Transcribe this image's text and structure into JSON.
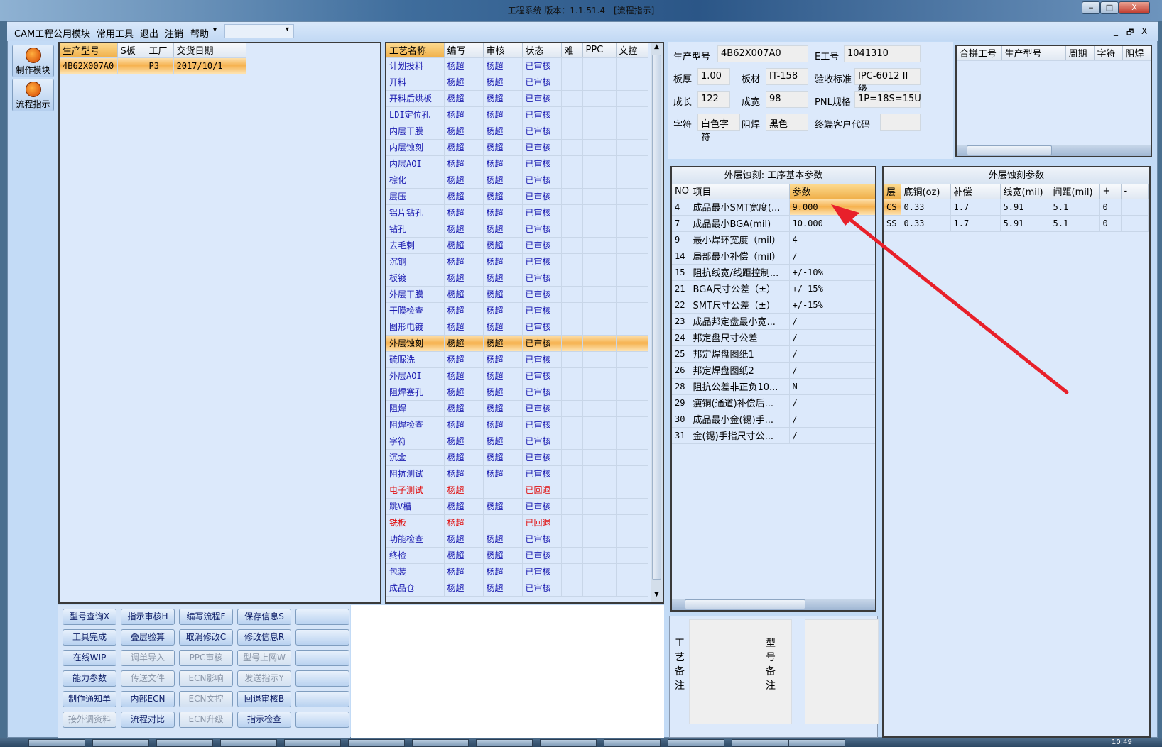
{
  "window": {
    "title": "工程系统  版本：1.1.51.4 - [流程指示]",
    "min": "‒",
    "max": "□",
    "close": "X",
    "mdi_min": "_",
    "mdi_restore": "🗗",
    "mdi_close": "X"
  },
  "menu": [
    "CAM工程",
    "公用模块",
    "常用工具",
    "退出",
    "注销",
    "帮助"
  ],
  "menu_more": "▾",
  "menu_combo": {
    "value": "",
    "arrow": "▾"
  },
  "nav": [
    {
      "label": "制作模块",
      "icon": "fire-icon"
    },
    {
      "label": "流程指示",
      "icon": "flow-icon"
    }
  ],
  "orders": {
    "columns": [
      "生产型号",
      "S板",
      "工厂",
      "交货日期"
    ],
    "rows": [
      [
        "4B62X007A0",
        "",
        "P3",
        "2017/10/1"
      ]
    ]
  },
  "process": {
    "columns": [
      "工艺名称",
      "编写",
      "审核",
      "状态",
      "难",
      "PPC",
      "文控"
    ],
    "rows": [
      [
        "计划投料",
        "杨超",
        "杨超",
        "已审核"
      ],
      [
        "开料",
        "杨超",
        "杨超",
        "已审核"
      ],
      [
        "开料后烘板",
        "杨超",
        "杨超",
        "已审核"
      ],
      [
        "LDI定位孔",
        "杨超",
        "杨超",
        "已审核"
      ],
      [
        "内层干膜",
        "杨超",
        "杨超",
        "已审核"
      ],
      [
        "内层蚀刻",
        "杨超",
        "杨超",
        "已审核"
      ],
      [
        "内层AOI",
        "杨超",
        "杨超",
        "已审核"
      ],
      [
        "棕化",
        "杨超",
        "杨超",
        "已审核"
      ],
      [
        "层压",
        "杨超",
        "杨超",
        "已审核"
      ],
      [
        "铝片钻孔",
        "杨超",
        "杨超",
        "已审核"
      ],
      [
        "钻孔",
        "杨超",
        "杨超",
        "已审核"
      ],
      [
        "去毛刺",
        "杨超",
        "杨超",
        "已审核"
      ],
      [
        "沉铜",
        "杨超",
        "杨超",
        "已审核"
      ],
      [
        "板镀",
        "杨超",
        "杨超",
        "已审核"
      ],
      [
        "外层干膜",
        "杨超",
        "杨超",
        "已审核"
      ],
      [
        "干膜检查",
        "杨超",
        "杨超",
        "已审核"
      ],
      [
        "图形电镀",
        "杨超",
        "杨超",
        "已审核"
      ],
      [
        "外层蚀刻",
        "杨超",
        "杨超",
        "已审核"
      ],
      [
        "硫脲洗",
        "杨超",
        "杨超",
        "已审核"
      ],
      [
        "外层AOI",
        "杨超",
        "杨超",
        "已审核"
      ],
      [
        "阻焊塞孔",
        "杨超",
        "杨超",
        "已审核"
      ],
      [
        "阻焊",
        "杨超",
        "杨超",
        "已审核"
      ],
      [
        "阻焊检查",
        "杨超",
        "杨超",
        "已审核"
      ],
      [
        "字符",
        "杨超",
        "杨超",
        "已审核"
      ],
      [
        "沉金",
        "杨超",
        "杨超",
        "已审核"
      ],
      [
        "阻抗测试",
        "杨超",
        "杨超",
        "已审核"
      ],
      [
        "电子测试",
        "杨超",
        "",
        "已回退"
      ],
      [
        "跳V槽",
        "杨超",
        "杨超",
        "已审核"
      ],
      [
        "铣板",
        "杨超",
        "",
        "已回退"
      ],
      [
        "功能检查",
        "杨超",
        "杨超",
        "已审核"
      ],
      [
        "终检",
        "杨超",
        "杨超",
        "已审核"
      ],
      [
        "包装",
        "杨超",
        "杨超",
        "已审核"
      ],
      [
        "成品仓",
        "杨超",
        "杨超",
        "已审核"
      ]
    ],
    "selected_index": 17,
    "rejected_color": "#e01010",
    "normal_color": "#1a1ab0"
  },
  "buttons": [
    [
      {
        "label": "型号查询X",
        "enabled": true
      },
      {
        "label": "指示审核H",
        "enabled": true
      },
      {
        "label": "编写流程F",
        "enabled": true
      },
      {
        "label": "保存信息S",
        "enabled": true
      },
      {
        "label": "",
        "enabled": true
      }
    ],
    [
      {
        "label": "工具完成",
        "enabled": true
      },
      {
        "label": "叠层验算",
        "enabled": true
      },
      {
        "label": "取消修改C",
        "enabled": true
      },
      {
        "label": "修改信息R",
        "enabled": true
      },
      {
        "label": "",
        "enabled": true
      }
    ],
    [
      {
        "label": "在线WIP",
        "enabled": true
      },
      {
        "label": "调单导入",
        "enabled": false
      },
      {
        "label": "PPC审核",
        "enabled": false
      },
      {
        "label": "型号上网W",
        "enabled": false
      },
      {
        "label": "",
        "enabled": true
      }
    ],
    [
      {
        "label": "能力参数",
        "enabled": true
      },
      {
        "label": "传送文件",
        "enabled": false
      },
      {
        "label": "ECN影响",
        "enabled": false
      },
      {
        "label": "发送指示Y",
        "enabled": false
      },
      {
        "label": "",
        "enabled": true
      }
    ],
    [
      {
        "label": "制作通知单",
        "enabled": true
      },
      {
        "label": "内部ECN",
        "enabled": true
      },
      {
        "label": "ECN文控",
        "enabled": false
      },
      {
        "label": "回退审核B",
        "enabled": true
      },
      {
        "label": "",
        "enabled": true
      }
    ],
    [
      {
        "label": "接外调资料",
        "enabled": false
      },
      {
        "label": "流程对比",
        "enabled": true
      },
      {
        "label": "ECN升级",
        "enabled": false
      },
      {
        "label": "指示检查",
        "enabled": true
      },
      {
        "label": "",
        "enabled": true
      }
    ]
  ],
  "info": {
    "model_label": "生产型号",
    "model": "4B62X007A0",
    "eno_label": "E工号",
    "eno": "1041310",
    "thick_label": "板厚",
    "thick": "1.00",
    "material_label": "板材",
    "material": "IT-158",
    "std_label": "验收标准",
    "std": "IPC-6012 II级",
    "len_label": "成长",
    "len": "122",
    "wid_label": "成宽",
    "wid": "98",
    "pnl_label": "PNL规格",
    "pnl": "1P=18S=15U",
    "char_label": "字符",
    "char": "白色字符",
    "mask_label": "阻焊",
    "mask": "黑色",
    "cust_label": "终端客户代码",
    "cust": ""
  },
  "merge": {
    "columns": [
      "合拼工号",
      "生产型号",
      "周期",
      "字符",
      "阻焊"
    ]
  },
  "params": {
    "title": "外层蚀刻: 工序基本参数",
    "columns": [
      "NO",
      "项目",
      "参数"
    ],
    "rows": [
      [
        "4",
        "成品最小SMT宽度(...",
        "9.000"
      ],
      [
        "7",
        "成品最小BGA(mil)",
        "10.000"
      ],
      [
        "9",
        "最小焊环宽度（mil）",
        "4"
      ],
      [
        "14",
        "局部最小补偿（mil）",
        "/"
      ],
      [
        "15",
        "阻抗线宽/线距控制...",
        "+/-10%"
      ],
      [
        "21",
        "BGA尺寸公差（±）",
        "+/-15%"
      ],
      [
        "22",
        "SMT尺寸公差（±）",
        "+/-15%"
      ],
      [
        "23",
        "成品邦定盘最小宽...",
        "/"
      ],
      [
        "24",
        "邦定盘尺寸公差",
        "/"
      ],
      [
        "25",
        "邦定焊盘图纸1",
        "/"
      ],
      [
        "26",
        "邦定焊盘图纸2",
        "/"
      ],
      [
        "28",
        "阻抗公差非正负10...",
        "N"
      ],
      [
        "29",
        "瘦铜(通道)补偿后...",
        "/"
      ],
      [
        "30",
        "成品最小金(锡)手...",
        "/"
      ],
      [
        "31",
        "金(锡)手指尺寸公...",
        "/"
      ]
    ],
    "selected_index": 0
  },
  "etch": {
    "title": "外层蚀刻参数",
    "columns": [
      "层",
      "底铜(oz)",
      "补偿",
      "线宽(mil)",
      "间距(mil)",
      "+",
      "-"
    ],
    "rows": [
      [
        "CS",
        "0.33",
        "1.7",
        "5.91",
        "5.1",
        "0",
        ""
      ],
      [
        "SS",
        "0.33",
        "1.7",
        "5.91",
        "5.1",
        "0",
        ""
      ]
    ]
  },
  "notes": {
    "process_label": "工艺备注",
    "model_label": "型号备注",
    "process": "",
    "model": ""
  },
  "taskbar": {
    "clock": "10:49"
  },
  "annotation": {
    "arrow_color": "#e8202a"
  }
}
